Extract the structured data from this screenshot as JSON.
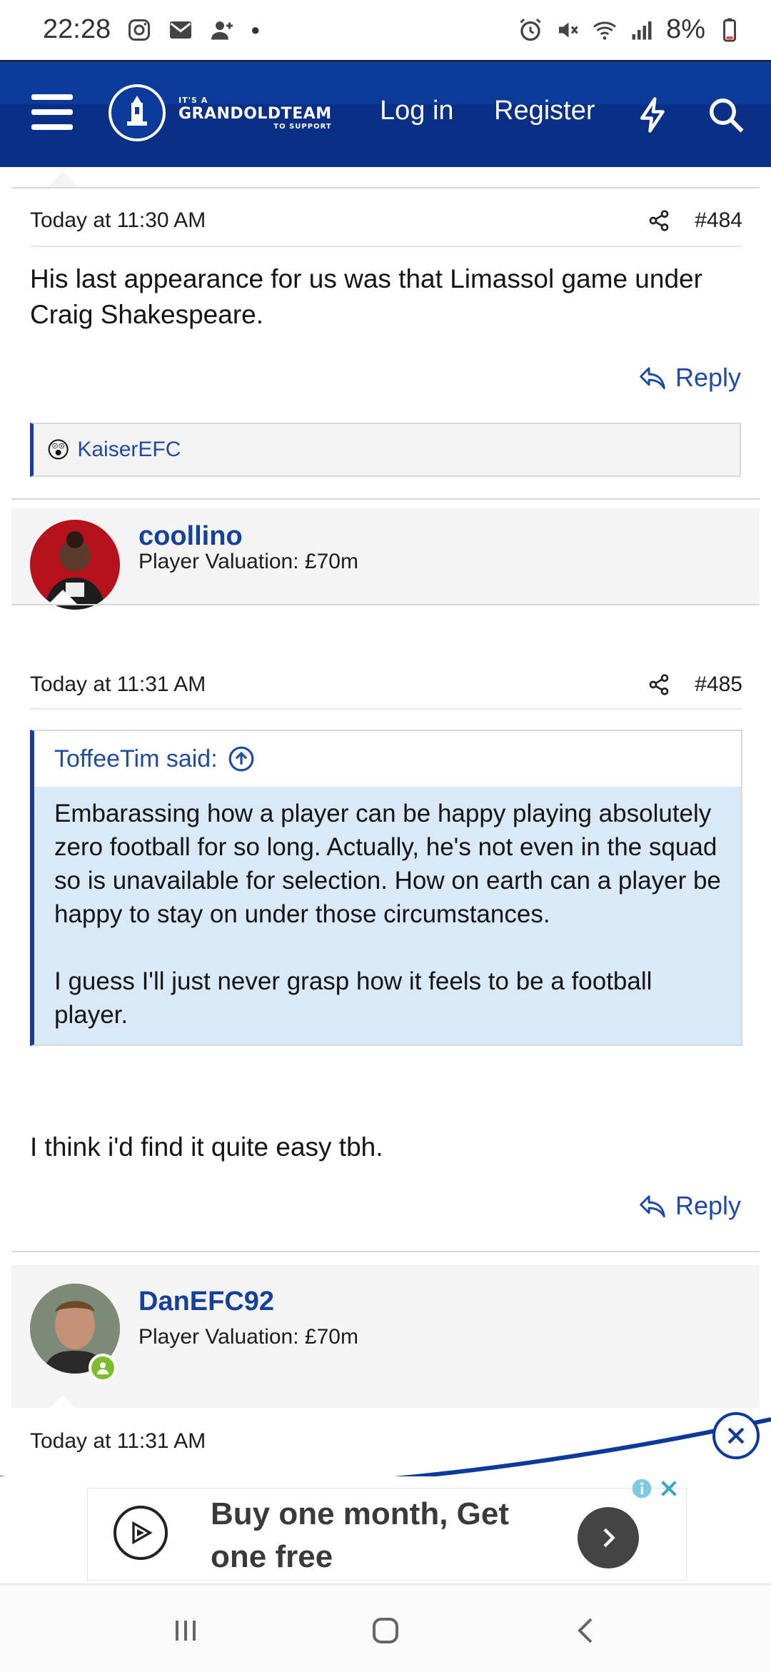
{
  "status_bar": {
    "time": "22:28",
    "battery": "8%",
    "left_icons": [
      "instagram-icon",
      "mail-icon",
      "add-contact-icon",
      "dot-icon"
    ],
    "right_icons": [
      "alarm-icon",
      "mute-icon",
      "wifi-icon",
      "signal-icon",
      "battery-icon"
    ]
  },
  "navbar": {
    "logo": {
      "small": "IT'S A",
      "big": "GRANDOLDTEAM",
      "sub": "TO SUPPORT"
    },
    "login": "Log in",
    "register": "Register",
    "icons": [
      "menu-icon",
      "lightning-icon",
      "search-icon"
    ],
    "colors": {
      "primary": "#0b3a9c",
      "band": "#0a2f86"
    }
  },
  "posts": [
    {
      "time": "Today at 11:30 AM",
      "number": "#484",
      "text": "His last appearance for us was that Limassol game under Craig Shakespeare.",
      "reply": "Reply",
      "reaction_user": "KaiserEFC",
      "reaction_emoji": "😲"
    },
    {
      "username": "coollino",
      "valuation": "Player Valuation: £70m",
      "time": "Today at 11:31 AM",
      "number": "#485",
      "quote_author": "ToffeeTim said:",
      "quote_p1": "Embarassing how a player can be happy playing absolutely zero football for so long. Actually, he's not even in the squad so is unavailable for selection. How on earth can a player be happy to stay on under those circumstances.",
      "quote_p2": "I guess I'll just never grasp how it feels to be a football player.",
      "text": "I think i'd find it quite easy tbh.",
      "reply": "Reply"
    },
    {
      "username": "DanEFC92",
      "valuation": "Player Valuation: £70m",
      "time": "Today at 11:31 AM"
    }
  ],
  "ad": {
    "text": "Buy one month, Get one free"
  }
}
